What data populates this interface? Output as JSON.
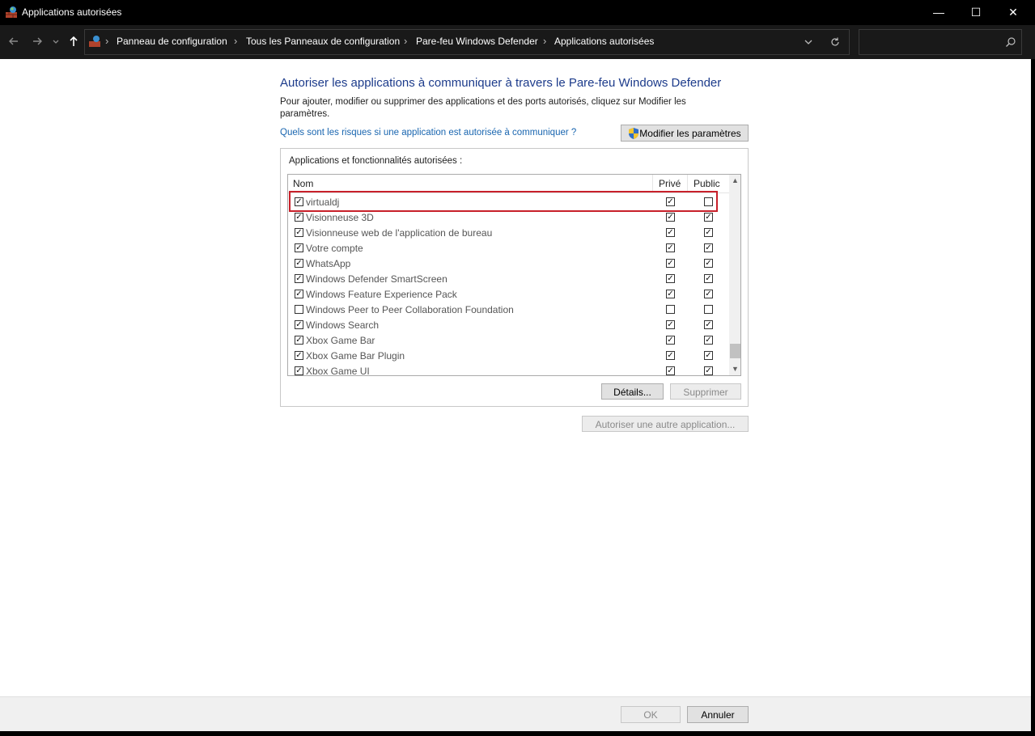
{
  "window": {
    "title": "Applications autorisées",
    "minimize_glyph": "—",
    "maximize_glyph": "☐",
    "close_glyph": "✕"
  },
  "address_bar": {
    "breadcrumbs": [
      "Panneau de configuration",
      "Tous les Panneaux de configuration",
      "Pare-feu Windows Defender",
      "Applications autorisées"
    ],
    "search_placeholder": ""
  },
  "main": {
    "heading": "Autoriser les applications à communiquer à travers le Pare-feu Windows Defender",
    "description": "Pour ajouter, modifier ou supprimer des applications et des ports autorisés, cliquez sur Modifier les paramètres.",
    "risk_link": "Quels sont les risques si une application est autorisée à communiquer ?",
    "change_settings_button": "Modifier les paramètres",
    "group_label": "Applications et fonctionnalités autorisées :",
    "columns": {
      "name": "Nom",
      "private": "Privé",
      "public": "Public"
    },
    "rows": [
      {
        "name": "virtualdj",
        "enabled": true,
        "private": true,
        "public": false
      },
      {
        "name": "Visionneuse 3D",
        "enabled": true,
        "private": true,
        "public": true
      },
      {
        "name": "Visionneuse web de l'application de bureau",
        "enabled": true,
        "private": true,
        "public": true
      },
      {
        "name": "Votre compte",
        "enabled": true,
        "private": true,
        "public": true
      },
      {
        "name": "WhatsApp",
        "enabled": true,
        "private": true,
        "public": true
      },
      {
        "name": "Windows Defender SmartScreen",
        "enabled": true,
        "private": true,
        "public": true
      },
      {
        "name": "Windows Feature Experience Pack",
        "enabled": true,
        "private": true,
        "public": true
      },
      {
        "name": "Windows Peer to Peer Collaboration Foundation",
        "enabled": false,
        "private": false,
        "public": false
      },
      {
        "name": "Windows Search",
        "enabled": true,
        "private": true,
        "public": true
      },
      {
        "name": "Xbox Game Bar",
        "enabled": true,
        "private": true,
        "public": true
      },
      {
        "name": "Xbox Game Bar Plugin",
        "enabled": true,
        "private": true,
        "public": true
      },
      {
        "name": "Xbox Game UI",
        "enabled": true,
        "private": true,
        "public": true
      }
    ],
    "details_button": "Détails...",
    "delete_button": "Supprimer",
    "allow_other_button": "Autoriser une autre application..."
  },
  "footer": {
    "ok_button": "OK",
    "cancel_button": "Annuler"
  },
  "colors": {
    "heading": "#1c3b8b",
    "link": "#1a66b0",
    "highlight_box": "#c8202a",
    "title_bar": "#000000",
    "address_bar": "#191919"
  }
}
